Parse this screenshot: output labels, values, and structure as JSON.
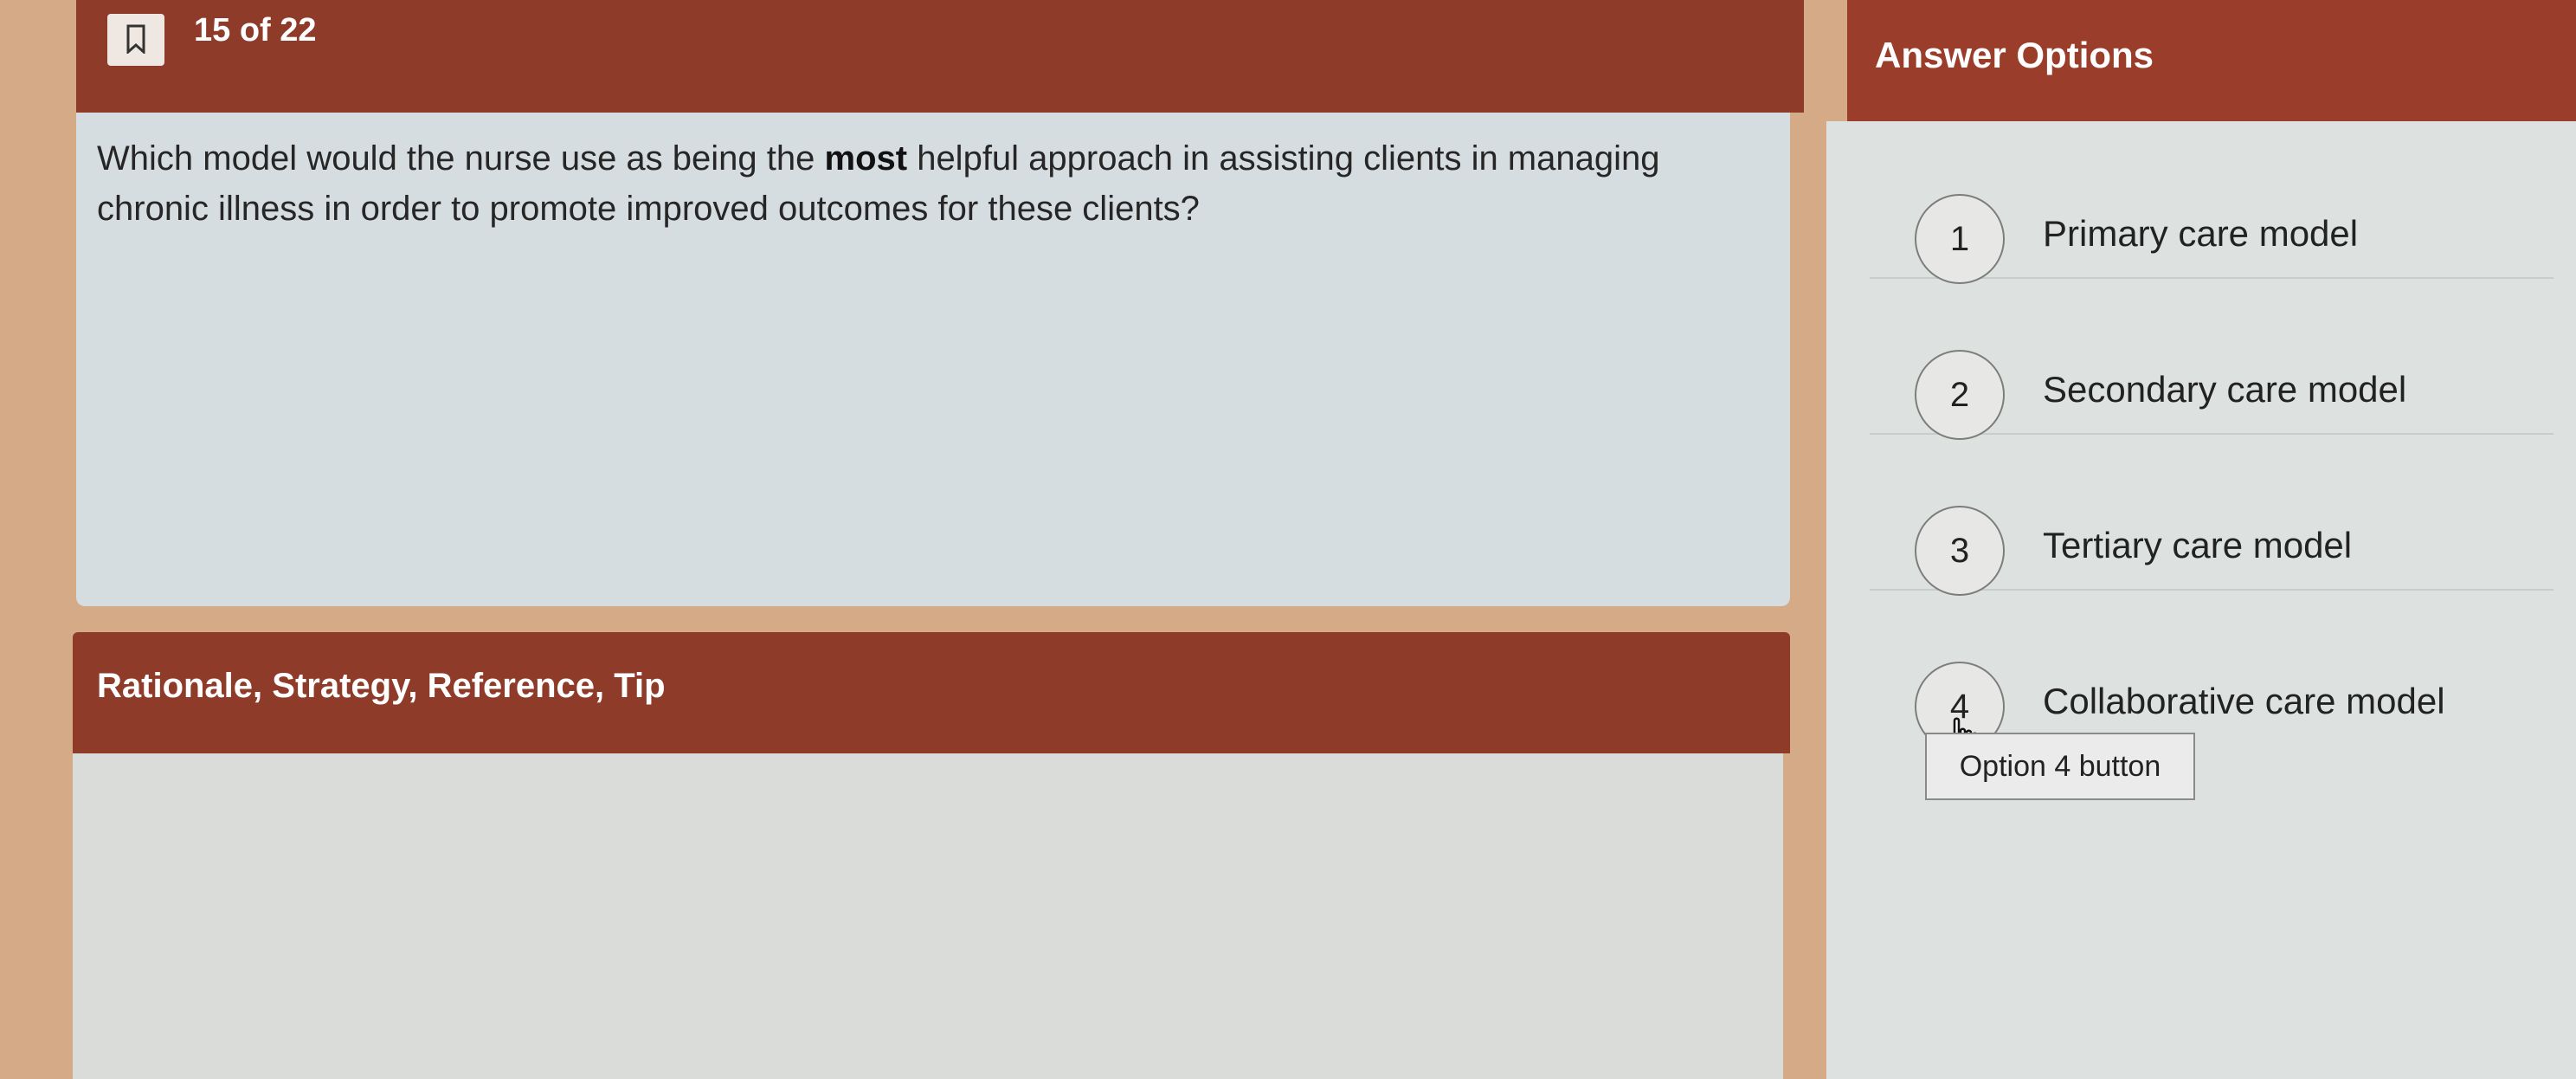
{
  "header": {
    "counter": "15 of 22"
  },
  "question": {
    "text_before": "Which model would the nurse use as being the ",
    "emphasis": "most",
    "text_after": " helpful approach in assisting clients in managing chronic illness in order to promote improved outcomes for these clients?"
  },
  "rationale": {
    "title": "Rationale, Strategy, Reference, Tip"
  },
  "answers": {
    "title": "Answer Options",
    "options": [
      {
        "number": "1",
        "label": "Primary care model"
      },
      {
        "number": "2",
        "label": "Secondary care model"
      },
      {
        "number": "3",
        "label": "Tertiary care model"
      },
      {
        "number": "4",
        "label": "Collaborative care model"
      }
    ]
  },
  "tooltip": {
    "text": "Option 4 button"
  },
  "icons": {
    "bookmark": "bookmark-icon",
    "cursor": "hand-pointer-icon"
  },
  "colors": {
    "header": "#8f3b29",
    "panel": "#d6dde0",
    "background": "#d5aa86"
  }
}
